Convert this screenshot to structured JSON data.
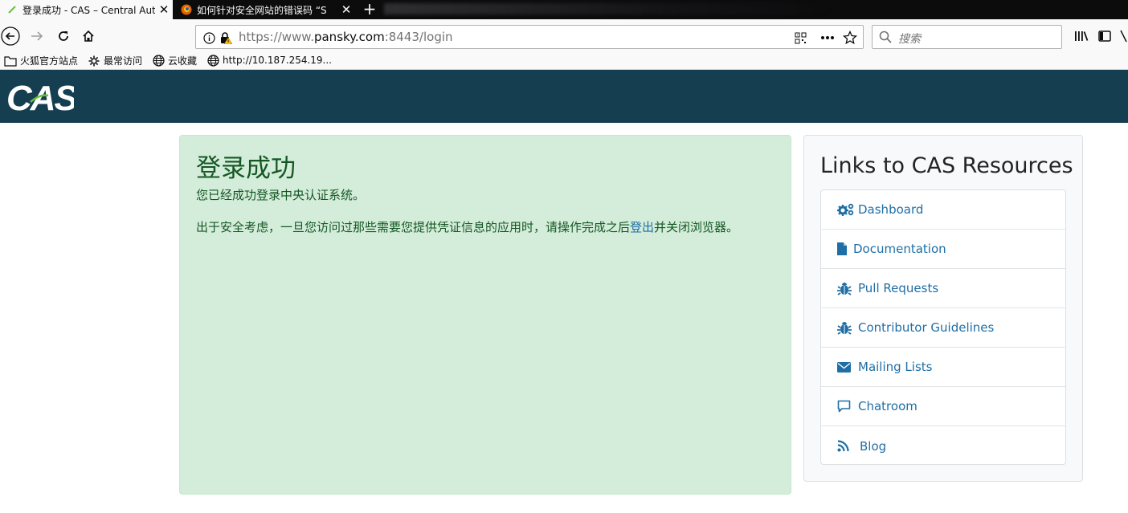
{
  "browser": {
    "tabs": [
      {
        "title": "登录成功 - CAS – Central Auth",
        "active": true
      },
      {
        "title": "如何针对安全网站的错误码 “S",
        "active": false
      }
    ],
    "new_tab_label": "+",
    "url": {
      "scheme": "https://www.",
      "host": "pansky.com",
      "rest": ":8443/login"
    },
    "search_placeholder": "搜索",
    "bookmarks": [
      {
        "label": "火狐官方站点",
        "icon": "folder-icon"
      },
      {
        "label": "最常访问",
        "icon": "gear-icon"
      },
      {
        "label": "云收藏",
        "icon": "globe-icon"
      },
      {
        "label": "http://10.187.254.19...",
        "icon": "globe-icon"
      }
    ]
  },
  "header": {
    "logo_text": "CAS",
    "brand_color": "#153e50"
  },
  "success": {
    "heading": "登录成功",
    "line1": "您已经成功登录中央认证系统。",
    "line2_before": "出于安全考虑，一旦您访问过那些需要您提供凭证信息的应用时，请操作完成之后",
    "logout_link": "登出",
    "line2_after": "并关闭浏览器。"
  },
  "resources": {
    "title": "Links to CAS Resources",
    "items": [
      {
        "label": "Dashboard",
        "icon": "cogs-icon"
      },
      {
        "label": "Documentation",
        "icon": "file-icon"
      },
      {
        "label": "Pull Requests",
        "icon": "bug-icon"
      },
      {
        "label": "Contributor Guidelines",
        "icon": "bug-icon"
      },
      {
        "label": "Mailing Lists",
        "icon": "envelope-icon"
      },
      {
        "label": "Chatroom",
        "icon": "comment-icon"
      },
      {
        "label": "Blog",
        "icon": "rss-icon"
      }
    ]
  }
}
